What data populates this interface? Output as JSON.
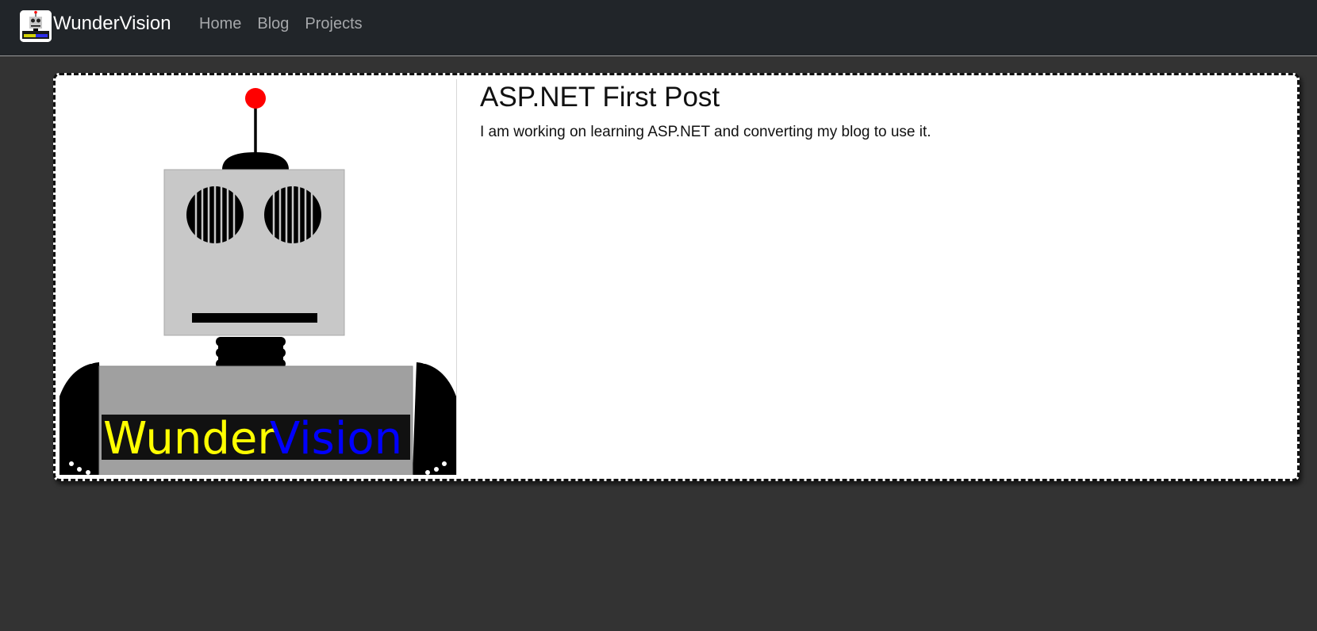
{
  "navbar": {
    "brand": "WunderVision",
    "links": [
      "Home",
      "Blog",
      "Projects"
    ]
  },
  "post": {
    "title": "ASP.NET First Post",
    "body": "I am working on learning ASP.NET and converting my blog to use it.",
    "image_logo_text": {
      "part1": "Wunder",
      "part2": "Vision"
    }
  },
  "colors": {
    "navbar_bg": "#212529",
    "page_bg": "#333333",
    "logo_yellow": "#ffff00",
    "logo_blue": "#0000ff",
    "antenna_red": "#ff0000"
  }
}
